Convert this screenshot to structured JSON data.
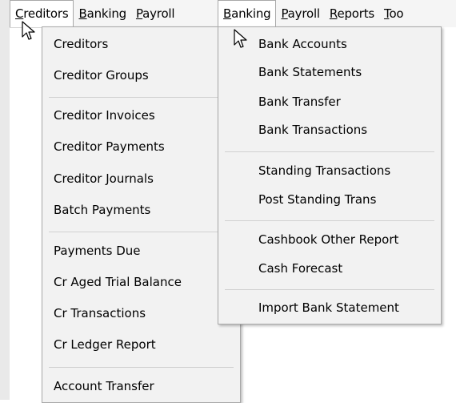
{
  "menubar_left": [
    {
      "hot": "C",
      "rest": "reditors"
    },
    {
      "hot": "B",
      "rest": "anking"
    },
    {
      "hot": "P",
      "rest": "ayroll"
    }
  ],
  "menubar_right": [
    {
      "hot": "B",
      "rest": "anking"
    },
    {
      "hot": "P",
      "rest": "ayroll"
    },
    {
      "hot": "R",
      "rest": "eports"
    },
    {
      "hot": "T",
      "rest": "oo"
    }
  ],
  "creditors_menu": {
    "items": [
      "Creditors",
      "Creditor Groups",
      "Creditor Invoices",
      "Creditor Payments",
      "Creditor Journals",
      "Batch Payments",
      "Payments Due",
      "Cr Aged Trial Balance",
      "Cr Transactions",
      "Cr Ledger Report",
      "Account Transfer"
    ]
  },
  "banking_menu": {
    "items": [
      "Bank Accounts",
      "Bank Statements",
      "Bank Transfer",
      "Bank Transactions",
      "Standing Transactions",
      "Post Standing Trans",
      "Cashbook Other Report",
      "Cash Forecast",
      "Import Bank Statement"
    ]
  },
  "colors": {
    "menu_bg": "#f2f2f2",
    "border": "#a8a8a8",
    "separator": "#d0d0d0"
  },
  "icons": [
    "arrow-cursor-icon"
  ]
}
